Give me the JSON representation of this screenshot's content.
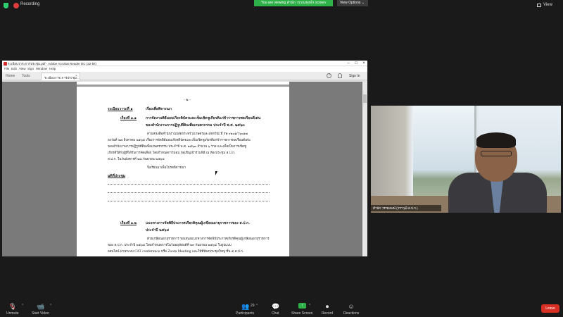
{
  "top_bar": {
    "recording_label": "Recording",
    "share_banner": "You are viewing สำนัก วรรณพงษ์'s screen",
    "view_options": "View Options ⌄",
    "view_label": "View"
  },
  "acrobat": {
    "title": "ระเบียบวาระการประชุม.pdf - Adobe Acrobat Reader DC (32-bit)",
    "menu": [
      "File",
      "Edit",
      "View",
      "Sign",
      "Window",
      "Help"
    ],
    "tabs": {
      "home": "Home",
      "tools": "Tools",
      "doc": "ระเบียบวาระการประชุม..."
    },
    "sign_in": "Sign In",
    "help": "?"
  },
  "pdf": {
    "page_num": "- ๒ -",
    "agenda_1": "ระเบียบวาระที่ ๑",
    "agenda_1_title": "เรื่องเพื่อพิจารณา",
    "item_11": "เรื่องที่ ๑.๑",
    "item_11_title_1": "การจัดงานพิธีมอบเกียรติบัตรและเข็มเชิดชูเกียรติแก่ข้าราชการพลเรือนดีเด่น",
    "item_11_title_2": "ของสำนักงานการปฏิรูปที่ดินเพื่อเกษตรกรรม ประจำปี พ.ศ. ๒๕๖๓",
    "body_1": "ตามหนังสือสำนักงานปลัดกระทรวงเกษตรและสหกรณ์ ที่ กษ ๐๒๐๑/ว๖๐๑๗",
    "body_2": "ลงวันที่ ๒๗ สิงหาคม ๒๕๖๔ เรื่องการจัดพิธีมอบเกียรติบัตรและเข็มเชิดชูเกียรติแก่ข้าราชการพลเรือนดีเด่น",
    "body_3": "ของสำนักงานการปฏิรูปที่ดินเพื่อเกษตรกรรม ประจำปี พ.ศ. ๒๕๖๓ จำนวน ๖ ราย และเพื่อเป็นการเชิดชู",
    "body_4": "เกียรติให้กับผู้ที่ได้รับการคัดเลือก โดยกำหนดการมอบ ขอเชิญเข้าร่วมพิธี ณ ห้องประชุม ส.ป.ก.",
    "body_5": "ส.ป.ก. ในวันอังคารที่ ๒๘ กันยายน ๒๕๖๔",
    "body_6": "จึงเรียนมาเพื่อโปรดพิจารณา",
    "resolution": "มติที่ประชุม",
    "item_12": "เรื่องที่ ๑.๒",
    "item_12_title_1": "แนวทางการจัดพิธีประกาศเกียรติคุณผู้เกษียณอายุราชการของ ส.ป.ก.",
    "item_12_title_2": "ประจำปี ๒๕๖๔",
    "body_7": "ด้วยเกษียณอายุราชการ ขอเสนอแนวทางการจัดพิธีประกาศเกียรติคุณผู้เกษียณอายุราชการ",
    "body_8": "ของ ส.ป.ก. ประจำปี ๒๕๖๔ โดยกำหนดการในวันพฤหัสบดีที่ ๒๓ กันยายน ๒๕๖๔ ในรูปแบบ",
    "body_9": "ออนไลน์ ผ่านระบบ CAT conference หรือ Zoom Meeting และให้ที่ห้องประชุมใหญ่ ชั้น ๕ ส.ป.ก."
  },
  "video": {
    "participant_name": "สำนัก วรรณพงษ์ (วราวุฒิ ส.ป.ก.)"
  },
  "bottom_bar": {
    "unmute": "Unmute",
    "start_video": "Start Video",
    "participants": "Participants",
    "participants_count": "29",
    "chat": "Chat",
    "share_screen": "Share Screen",
    "record": "Record",
    "reactions": "Reactions",
    "leave": "Leave"
  },
  "colors": {
    "share_green": "#2fb14a",
    "leave_red": "#d93025",
    "record_red": "#e03c3c"
  }
}
